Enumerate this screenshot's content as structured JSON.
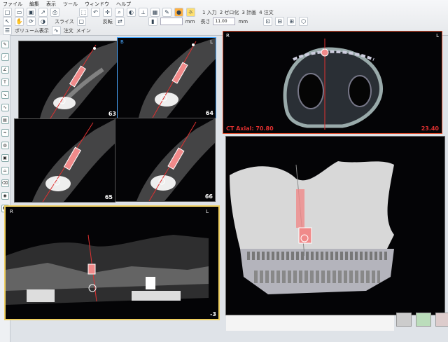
{
  "menu": [
    "ファイル",
    "編集",
    "表示",
    "ツール",
    "ウィンドウ",
    "ヘルプ"
  ],
  "toolbar": {
    "btn1": "1 入力",
    "btn2": "2 ゼロ化",
    "btn3": "3 計画",
    "btn4": "4 注文",
    "mm_label": "mm",
    "length_label": "長さ",
    "length_value": "11.00",
    "mm_label2": "mm",
    "crop_label": "スライス",
    "reverse_label": "反転",
    "label_bottom": "ボリューム表示",
    "label_order": "注文",
    "label_main": "メイン"
  },
  "views": {
    "sag63": {
      "slice": "63"
    },
    "sag64": {
      "slice": "64",
      "tl": "B",
      "tr": "L"
    },
    "sag65": {
      "slice": "65"
    },
    "sag66": {
      "slice": "66"
    },
    "pano": {
      "tl": "R",
      "tr": "L",
      "slice": "-3"
    },
    "axial": {
      "tl": "R",
      "tr": "L",
      "title": "CT Axial: 70.80",
      "value": "23.40"
    }
  },
  "colors": {
    "accent_blue": "#4aa8ff",
    "accent_red": "#e03030",
    "implant_pink": "#f08a8a",
    "pano_border": "#f0d060"
  }
}
